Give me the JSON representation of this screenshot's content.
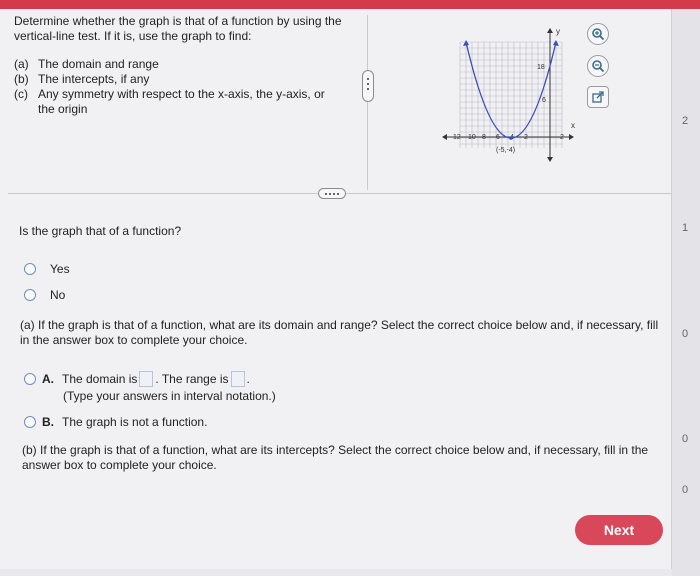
{
  "question": {
    "intro": "Determine whether the graph is that of a function by using the vertical-line test. If it is, use the graph to find:",
    "items": [
      {
        "label": "(a)",
        "text": "The domain and range"
      },
      {
        "label": "(b)",
        "text": "The intercepts, if any"
      },
      {
        "label": "(c)",
        "text": "Any symmetry with respect to the x-axis, the y-axis, or the origin"
      }
    ]
  },
  "graph": {
    "y_axis_label": "y",
    "x_axis_label": "x",
    "y_tick_18": "18",
    "y_tick_6": "6",
    "x_ticks": [
      "12",
      "10",
      "8",
      "6",
      "4",
      "2",
      "2"
    ],
    "point_label": "(-5,-4)",
    "curve_color": "#3a4fb5"
  },
  "tools": {
    "zoom_in_icon": "magnifier-plus-icon",
    "zoom_out_icon": "magnifier-minus-icon",
    "popout_icon": "external-link-icon"
  },
  "is_function": {
    "prompt": "Is the graph that of a function?",
    "options": [
      "Yes",
      "No"
    ]
  },
  "part_a": {
    "prompt": "(a) If the graph is that of a function, what are its domain and range? Select the correct choice below and, if necessary, fill in the answer box to complete your choice.",
    "choice_a_letter": "A.",
    "choice_a_text1": "The domain is",
    "choice_a_text2": ". The range is",
    "choice_a_end": ".",
    "hint": "(Type your answers in interval notation.)",
    "choice_b_letter": "B.",
    "choice_b_text": "The graph is not a function."
  },
  "part_b": {
    "prompt": "(b) If the graph is that of a function, what are its intercepts? Select the correct choice below and, if necessary, fill in the answer box to complete your choice."
  },
  "gutter": [
    "2",
    "1",
    "0",
    "0",
    "0"
  ],
  "next_label": "Next",
  "colors": {
    "accent": "#d9485a",
    "radio": "#6d8fbf"
  }
}
